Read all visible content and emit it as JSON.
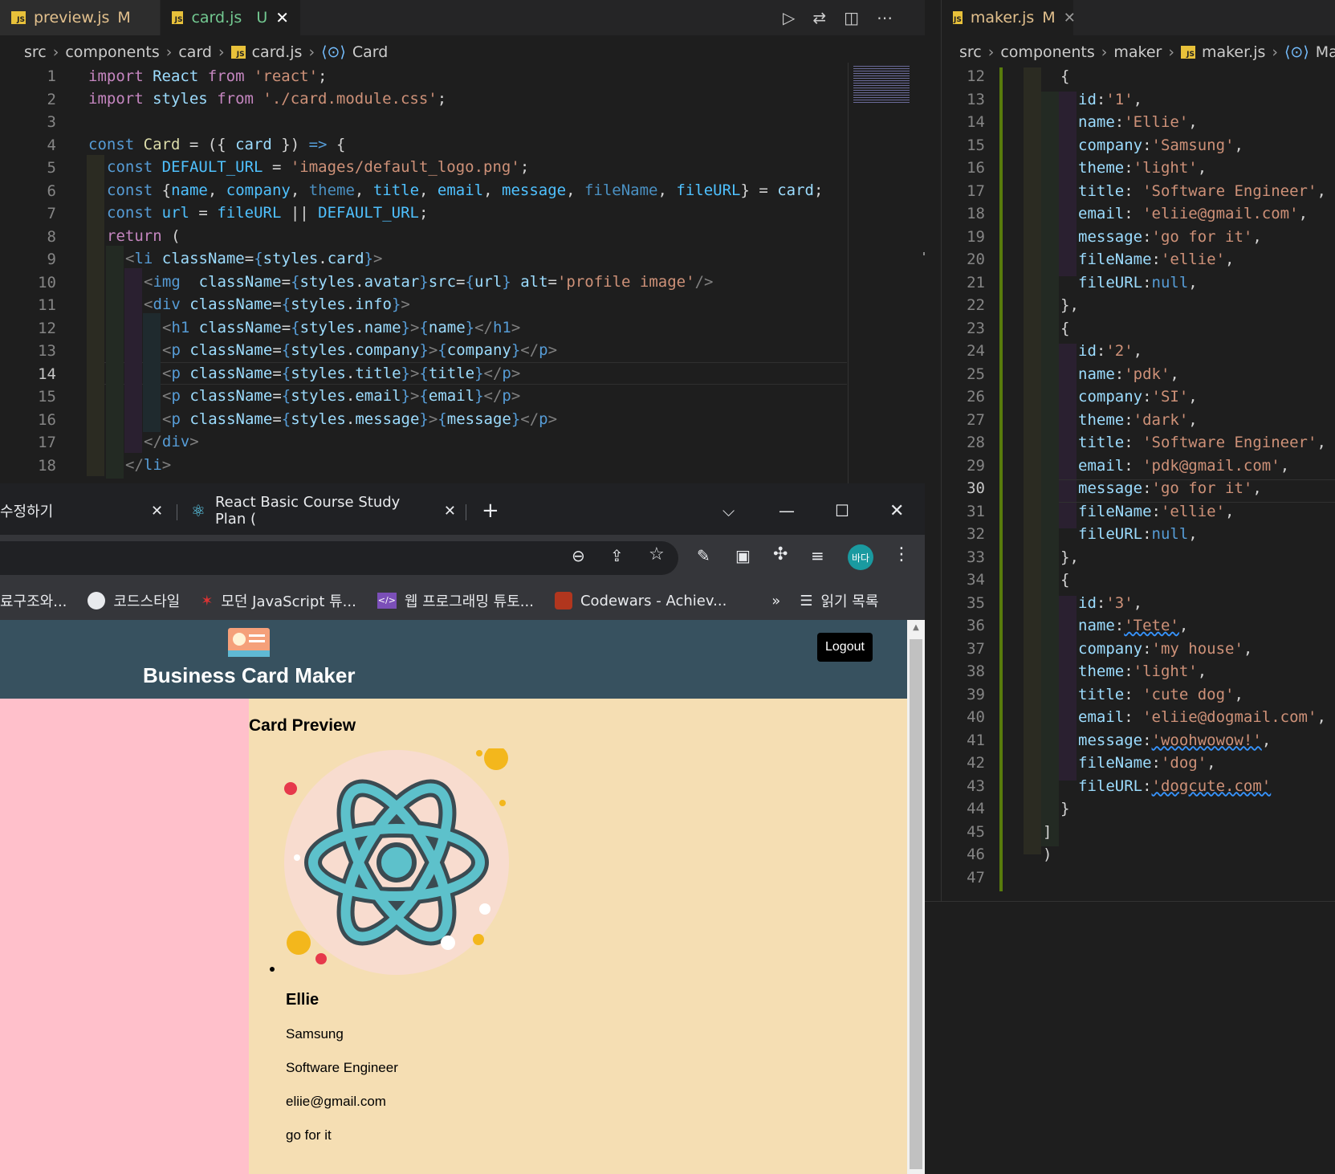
{
  "left_editor": {
    "tabs": [
      {
        "file": "preview.js",
        "status": "M"
      },
      {
        "file": "card.js",
        "status": "U"
      }
    ],
    "breadcrumb": [
      "src",
      "components",
      "card",
      "card.js",
      "Card"
    ],
    "current_line": "14",
    "line_numbers": [
      "1",
      "2",
      "3",
      "4",
      "5",
      "6",
      "7",
      "8",
      "9",
      "10",
      "11",
      "12",
      "13",
      "14",
      "15",
      "16",
      "17",
      "18"
    ]
  },
  "right_editor": {
    "tabs": [
      {
        "file": "maker.js",
        "status": "M"
      }
    ],
    "breadcrumb": [
      "src",
      "components",
      "maker",
      "maker.js",
      "Maker"
    ],
    "current_line": "30",
    "line_numbers": [
      "12",
      "13",
      "14",
      "15",
      "16",
      "17",
      "18",
      "19",
      "20",
      "21",
      "22",
      "23",
      "24",
      "25",
      "26",
      "27",
      "28",
      "29",
      "30",
      "31",
      "32",
      "33",
      "34",
      "35",
      "36",
      "37",
      "38",
      "39",
      "40",
      "41",
      "42",
      "43",
      "44",
      "45",
      "46",
      "47"
    ],
    "cards": [
      {
        "id": "'1'",
        "name": "'Ellie'",
        "company": "'Samsung'",
        "theme": "'light'",
        "title": "'Software Engineer'",
        "email": "'eliie@gmail.com'",
        "message": "'go for it'",
        "fileName": "'ellie'",
        "fileURL": "null"
      },
      {
        "id": "'2'",
        "name": "'pdk'",
        "company": "'SI'",
        "theme": "'dark'",
        "title": "'Software Engineer'",
        "email": "'pdk@gmail.com'",
        "message": "'go for it'",
        "fileName": "'ellie'",
        "fileURL": "null"
      },
      {
        "id": "'3'",
        "name": "'Tete'",
        "company": "'my house'",
        "theme": "'light'",
        "title": "'cute dog'",
        "email": "'eliie@dogmail.com'",
        "message": "'woohwowow!'",
        "fileName": "'dog'",
        "fileURL": "'dogcute.com'"
      }
    ]
  },
  "browser": {
    "tabs": [
      {
        "title": "수정하기"
      },
      {
        "title": "React Basic Course Study Plan ("
      }
    ],
    "bookmarks": [
      "료구조와...",
      "코드스타일",
      "모던 JavaScript 튜...",
      "웹 프로그래밍 튜토...",
      "Codewars - Achiev..."
    ],
    "overflow_label": "»",
    "reading_list": "읽기 목록",
    "profile_label": "바다",
    "app": {
      "title": "Business Card Maker",
      "logout_label": "Logout",
      "preview_title": "Card Preview",
      "card": {
        "name": "Ellie",
        "company": "Samsung",
        "title": "Software Engineer",
        "email": "eliie@gmail.com",
        "message": "go for it"
      }
    }
  },
  "colors": {
    "editor_bg": "#1e1e1e",
    "header_bg": "#37515f",
    "editor_panel_bg": "#ffc0cb",
    "preview_bg": "#f5deb3",
    "react_icon": "#5dc1cb"
  }
}
